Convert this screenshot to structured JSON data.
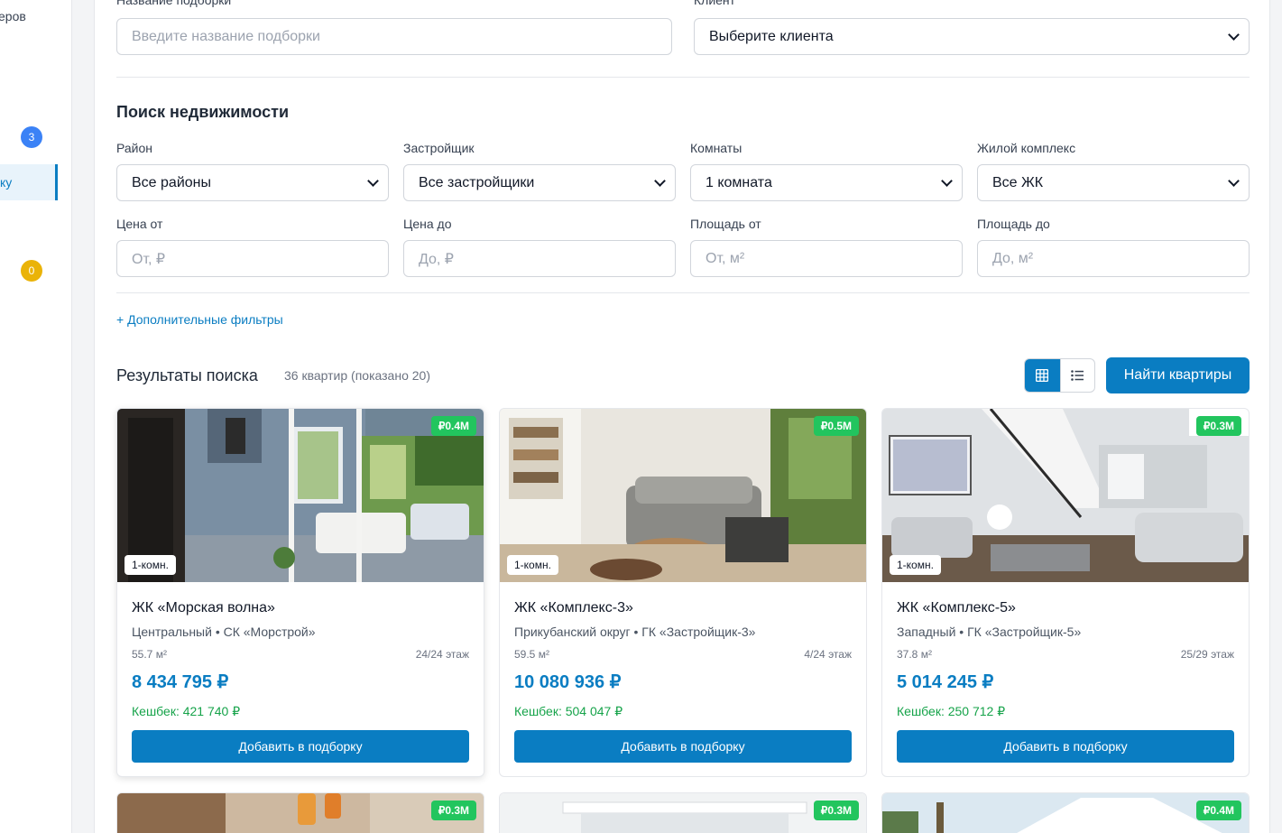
{
  "sidebar": {
    "partial_text": "еров",
    "badge_1": "3",
    "active_item_partial": "ку",
    "badge_2": "0"
  },
  "form": {
    "collection_name_label": "Название подборки",
    "collection_name_placeholder": "Введите название подборки",
    "client_label": "Клиент",
    "client_value": "Выберите клиента"
  },
  "search": {
    "title": "Поиск недвижимости",
    "district_label": "Район",
    "district_value": "Все районы",
    "developer_label": "Застройщик",
    "developer_value": "Все застройщики",
    "rooms_label": "Комнаты",
    "rooms_value": "1 комната",
    "complex_label": "Жилой комплекс",
    "complex_value": "Все ЖК",
    "price_from_label": "Цена от",
    "price_from_placeholder": "От, ₽",
    "price_to_label": "Цена до",
    "price_to_placeholder": "До, ₽",
    "area_from_label": "Площадь от",
    "area_from_placeholder": "От, м²",
    "area_to_label": "Площадь до",
    "area_to_placeholder": "До, м²",
    "more_filters": "+ Дополнительные фильтры"
  },
  "results": {
    "title": "Результаты поиска",
    "count": "36 квартир (показано 20)",
    "find_button": "Найти квартиры",
    "cards": [
      {
        "badge": "₽0.4M",
        "rooms": "1-комн.",
        "title": "ЖК «Морская волна»",
        "subtitle": "Центральный • СК «Морстрой»",
        "area": "55.7 м²",
        "floor": "24/24 этаж",
        "price": "8 434 795 ₽",
        "cashback": "Кешбек: 421 740 ₽",
        "button": "Добавить в подборку"
      },
      {
        "badge": "₽0.5M",
        "rooms": "1-комн.",
        "title": "ЖК «Комплекс-3»",
        "subtitle": "Прикубанский округ • ГК «Застройщик-3»",
        "area": "59.5 м²",
        "floor": "4/24 этаж",
        "price": "10 080 936 ₽",
        "cashback": "Кешбек: 504 047 ₽",
        "button": "Добавить в подборку"
      },
      {
        "badge": "₽0.3M",
        "rooms": "1-комн.",
        "title": "ЖК «Комплекс-5»",
        "subtitle": "Западный • ГК «Застройщик-5»",
        "area": "37.8 м²",
        "floor": "25/29 этаж",
        "price": "5 014 245 ₽",
        "cashback": "Кешбек: 250 712 ₽",
        "button": "Добавить в подборку"
      }
    ],
    "row2_badges": [
      "₽0.3M",
      "₽0.3M",
      "₽0.4M"
    ]
  },
  "colors": {
    "primary": "#0a7dc2",
    "badge_green": "#22c55e",
    "cashback_green": "#16a34a"
  },
  "icons": {
    "grid_view": "grid-icon",
    "list_view": "list-icon"
  }
}
